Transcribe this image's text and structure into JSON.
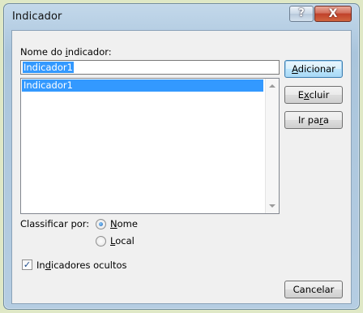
{
  "window": {
    "title": "Indicador",
    "help_glyph": "?",
    "close_glyph": "X"
  },
  "name_label_parts": [
    "Nome do ",
    "i",
    "ndicador:"
  ],
  "name_input_value": "Indicador1",
  "list_items": [
    "Indicador1"
  ],
  "buttons": {
    "add": [
      "",
      "A",
      "dicionar"
    ],
    "delete": [
      "E",
      "x",
      "cluir"
    ],
    "goto": [
      "Ir pa",
      "r",
      "a"
    ],
    "cancel": "Cancelar"
  },
  "sort": {
    "label": "Classificar por:",
    "options": [
      {
        "parts": [
          "",
          "N",
          "ome"
        ],
        "checked": true
      },
      {
        "parts": [
          "",
          "L",
          "ocal"
        ],
        "checked": false
      }
    ]
  },
  "hidden_checkbox": {
    "parts": [
      "In",
      "d",
      "icadores ocultos"
    ],
    "checked": true,
    "check_glyph": "✓"
  },
  "colors": {
    "selection": "#3399ff",
    "close_button": "#c0412a",
    "frame": "#b7cfe4"
  }
}
